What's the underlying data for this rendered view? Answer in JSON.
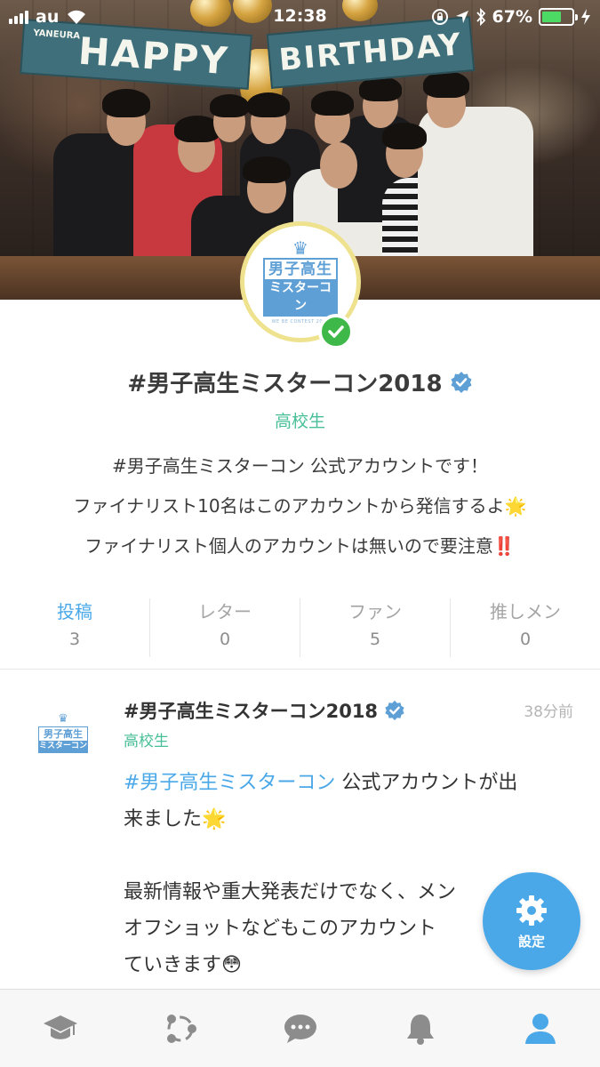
{
  "status_bar": {
    "carrier": "au",
    "time": "12:38",
    "battery": "67%",
    "battery_level": 0.67
  },
  "cover": {
    "banner_left": "HAPPY",
    "banner_right": "BIRTHDAY",
    "banner_logo": "YANEURA"
  },
  "profile": {
    "logo_line1": "男子高生",
    "logo_line2": "ミスターコン",
    "logo_sub": "WE BE CONTEST 2018",
    "name": "#男子高生ミスターコン2018",
    "category": "高校生",
    "bio": [
      "#男子高生ミスターコン 公式アカウントです！",
      "ファイナリスト10名はこのアカウントから発信するよ🌟",
      "ファイナリスト個人のアカウントは無いので要注意‼️"
    ]
  },
  "stats": [
    {
      "label": "投稿",
      "value": "3",
      "active": true
    },
    {
      "label": "レター",
      "value": "0",
      "active": false
    },
    {
      "label": "ファン",
      "value": "5",
      "active": false
    },
    {
      "label": "推しメン",
      "value": "0",
      "active": false
    }
  ],
  "post": {
    "author": "#男子高生ミスターコン2018",
    "time": "38分前",
    "category": "高校生",
    "hashtag": "#男子高生ミスターコン",
    "line1_rest": " 公式アカウントが出",
    "line2": "来ました🌟",
    "line3": "最新情報や重大発表だけでなく、メン",
    "line4": "オフショットなどもこのアカウント",
    "line5": "ていきます😳"
  },
  "fab": {
    "label": "設定",
    "icon": "gear-icon"
  },
  "tabbar": {
    "items": [
      {
        "icon": "graduation-cap-icon",
        "active": false
      },
      {
        "icon": "network-nodes-icon",
        "active": false
      },
      {
        "icon": "chat-bubble-icon",
        "active": false
      },
      {
        "icon": "bell-icon",
        "active": false
      },
      {
        "icon": "person-icon",
        "active": true
      }
    ]
  },
  "colors": {
    "accent": "#4aa8e8",
    "category_green": "#48bf98",
    "verified_green": "#3fb84a",
    "tab_inactive": "#8c8c8c"
  }
}
